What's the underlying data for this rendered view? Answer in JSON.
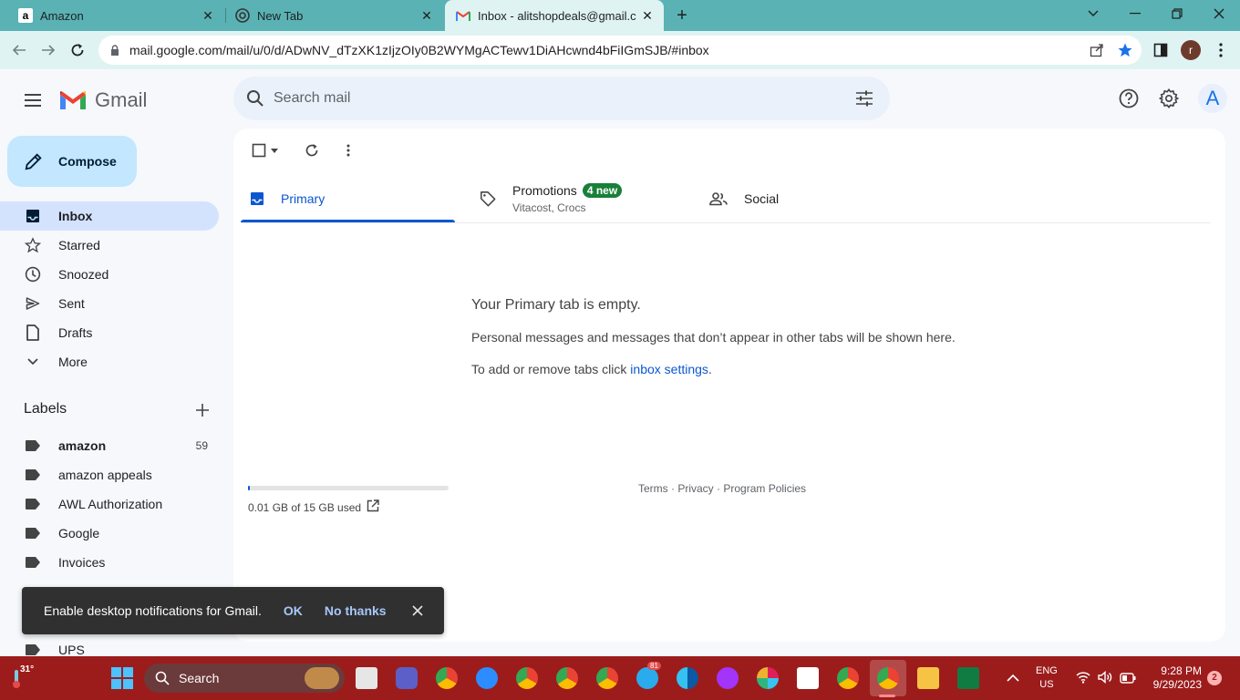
{
  "browser": {
    "tabs": [
      {
        "title": "Amazon",
        "favicon": "amazon-a"
      },
      {
        "title": "New Tab",
        "favicon": "chrome"
      },
      {
        "title": "Inbox - alitshopdeals@gmail.cor",
        "favicon": "gmail-m"
      }
    ],
    "url": "mail.google.com/mail/u/0/d/ADwNV_dTzXK1zIjzOIy0B2WYMgACTewv1DiAHcwnd4bFiIGmSJB/#inbox",
    "profile_initial": "r"
  },
  "gmail": {
    "brand": "Gmail",
    "search_placeholder": "Search mail",
    "account_initial": "A",
    "compose_label": "Compose",
    "nav": [
      {
        "label": "Inbox",
        "icon": "inbox-icon",
        "active": true
      },
      {
        "label": "Starred",
        "icon": "star-icon"
      },
      {
        "label": "Snoozed",
        "icon": "clock-icon"
      },
      {
        "label": "Sent",
        "icon": "send-icon"
      },
      {
        "label": "Drafts",
        "icon": "draft-icon"
      },
      {
        "label": "More",
        "icon": "chevron-down-icon"
      }
    ],
    "labels_header": "Labels",
    "labels": [
      {
        "name": "amazon",
        "count": "59",
        "bold": true
      },
      {
        "name": "amazon appeals"
      },
      {
        "name": "AWL Authorization"
      },
      {
        "name": "Google"
      },
      {
        "name": "Invoices"
      },
      {
        "name": "UPS"
      }
    ],
    "category_tabs": [
      {
        "label": "Primary",
        "active": true
      },
      {
        "label": "Promotions",
        "badge": "4 new",
        "subtitle": "Vitacost, Crocs"
      },
      {
        "label": "Social"
      }
    ],
    "empty_title": "Your Primary tab is empty.",
    "empty_desc": "Personal messages and messages that don’t appear in other tabs will be shown here.",
    "empty_settings_prefix": "To add or remove tabs click ",
    "empty_settings_link": "inbox settings",
    "empty_settings_suffix": ".",
    "storage": {
      "text": "0.01 GB of 15 GB used",
      "used_fraction": 0.0007
    },
    "footer": {
      "terms": "Terms",
      "sep": " · ",
      "privacy": "Privacy",
      "policies": "Program Policies"
    }
  },
  "toast": {
    "message": "Enable desktop notifications for Gmail.",
    "ok": "OK",
    "no_thanks": "No thanks"
  },
  "taskbar": {
    "weather_temp": "31°",
    "search_label": "Search",
    "lang_1": "ENG",
    "lang_2": "US",
    "time": "9:28 PM",
    "date": "9/29/2023",
    "notif_count": "2",
    "telegram_badge": "81"
  }
}
